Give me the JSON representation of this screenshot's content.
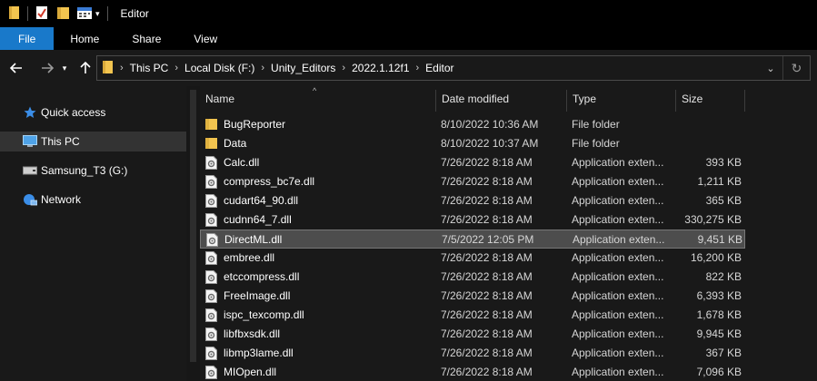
{
  "window": {
    "title": "Editor"
  },
  "ribbon": {
    "tabs": [
      "File",
      "Home",
      "Share",
      "View"
    ]
  },
  "address": {
    "crumbs": [
      "This PC",
      "Local Disk (F:)",
      "Unity_Editors",
      "2022.1.12f1",
      "Editor"
    ]
  },
  "sidebar": {
    "items": [
      {
        "label": "Quick access",
        "icon": "star-icon"
      },
      {
        "label": "This PC",
        "icon": "computer-icon"
      },
      {
        "label": "Samsung_T3 (G:)",
        "icon": "drive-icon"
      },
      {
        "label": "Network",
        "icon": "network-icon"
      }
    ]
  },
  "columns": {
    "name": "Name",
    "date": "Date modified",
    "type": "Type",
    "size": "Size"
  },
  "files": [
    {
      "name": "BugReporter",
      "date": "8/10/2022 10:36 AM",
      "type": "File folder",
      "size": "",
      "kind": "folder"
    },
    {
      "name": "Data",
      "date": "8/10/2022 10:37 AM",
      "type": "File folder",
      "size": "",
      "kind": "folder"
    },
    {
      "name": "Calc.dll",
      "date": "7/26/2022 8:18 AM",
      "type": "Application exten...",
      "size": "393 KB",
      "kind": "dll"
    },
    {
      "name": "compress_bc7e.dll",
      "date": "7/26/2022 8:18 AM",
      "type": "Application exten...",
      "size": "1,211 KB",
      "kind": "dll"
    },
    {
      "name": "cudart64_90.dll",
      "date": "7/26/2022 8:18 AM",
      "type": "Application exten...",
      "size": "365 KB",
      "kind": "dll"
    },
    {
      "name": "cudnn64_7.dll",
      "date": "7/26/2022 8:18 AM",
      "type": "Application exten...",
      "size": "330,275 KB",
      "kind": "dll"
    },
    {
      "name": "DirectML.dll",
      "date": "7/5/2022 12:05 PM",
      "type": "Application exten...",
      "size": "9,451 KB",
      "kind": "dll"
    },
    {
      "name": "embree.dll",
      "date": "7/26/2022 8:18 AM",
      "type": "Application exten...",
      "size": "16,200 KB",
      "kind": "dll"
    },
    {
      "name": "etccompress.dll",
      "date": "7/26/2022 8:18 AM",
      "type": "Application exten...",
      "size": "822 KB",
      "kind": "dll"
    },
    {
      "name": "FreeImage.dll",
      "date": "7/26/2022 8:18 AM",
      "type": "Application exten...",
      "size": "6,393 KB",
      "kind": "dll"
    },
    {
      "name": "ispc_texcomp.dll",
      "date": "7/26/2022 8:18 AM",
      "type": "Application exten...",
      "size": "1,678 KB",
      "kind": "dll"
    },
    {
      "name": "libfbxsdk.dll",
      "date": "7/26/2022 8:18 AM",
      "type": "Application exten...",
      "size": "9,945 KB",
      "kind": "dll"
    },
    {
      "name": "libmp3lame.dll",
      "date": "7/26/2022 8:18 AM",
      "type": "Application exten...",
      "size": "367 KB",
      "kind": "dll"
    },
    {
      "name": "MIOpen.dll",
      "date": "7/26/2022 8:18 AM",
      "type": "Application exten...",
      "size": "7,096 KB",
      "kind": "dll"
    }
  ],
  "selected_file": "DirectML.dll",
  "colors": {
    "accent": "#1979ca",
    "folder": "#f2c44f",
    "selection": "#4d4d4d"
  }
}
